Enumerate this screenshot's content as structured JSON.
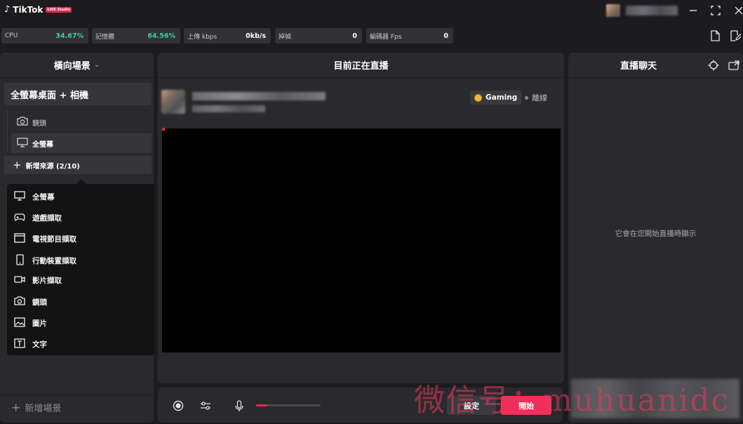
{
  "app": {
    "brand": "TikTok",
    "badge": "LIVE Studio"
  },
  "stats": {
    "cpu_label": "CPU",
    "cpu_value": "34.67%",
    "mem_label": "記憶體",
    "mem_value": "64.56%",
    "upload_label": "上傳 kbps",
    "upload_value": "0kb/s",
    "dropped_label": "掉幀",
    "dropped_value": "0",
    "encoder_label": "編碼器 Fps",
    "encoder_value": "0"
  },
  "left": {
    "header": "橫向場景",
    "scene_name": "全螢幕桌面 + 相機",
    "sources": [
      "鏡頭",
      "全螢幕"
    ],
    "add_source": "新增來源 (2/10)",
    "menu": [
      "全螢幕",
      "遊戲擷取",
      "電視節目擷取",
      "行動裝置擷取",
      "影片擷取",
      "鏡頭",
      "圖片",
      "文字"
    ],
    "add_scene": "新增場景"
  },
  "center": {
    "header": "目前正在直播",
    "category": "Gaming",
    "status": "離線"
  },
  "right": {
    "header": "直播聊天",
    "empty_message": "它會在您開始直播時顯示"
  },
  "bottom": {
    "settings_label": "設定",
    "start_label": "開始",
    "mic_level": 0.17
  },
  "watermark": "微信号：muhuanidc",
  "colors": {
    "accent": "#f0305a",
    "positive": "#3ccfa1",
    "background": "#1c1c1e",
    "panel": "#2a2a2d"
  }
}
